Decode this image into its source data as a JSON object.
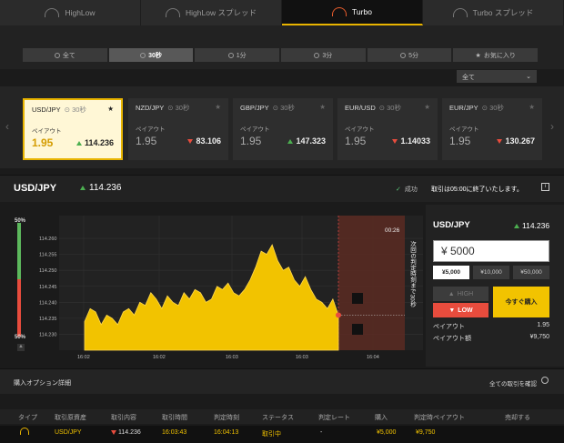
{
  "top_tabs": [
    {
      "label": "HighLow",
      "icon": "highlow-icon"
    },
    {
      "label": "HighLow スプレッド",
      "icon": "highlow-spread-icon"
    },
    {
      "label": "Turbo",
      "icon": "turbo-gauge-icon"
    },
    {
      "label": "Turbo スプレッド",
      "icon": "turbo-spread-icon"
    }
  ],
  "durations": [
    "全て",
    "30秒",
    "1分",
    "3分",
    "5分",
    "お気に入り"
  ],
  "filter": {
    "value": "全て"
  },
  "cards": [
    {
      "pair": "USD/JPY",
      "time": "30秒",
      "payout_label": "ペイアウト",
      "payout": "1.95",
      "price": "114.236",
      "dir": "up"
    },
    {
      "pair": "NZD/JPY",
      "time": "30秒",
      "payout_label": "ペイアウト",
      "payout": "1.95",
      "price": "83.106",
      "dir": "down"
    },
    {
      "pair": "GBP/JPY",
      "time": "30秒",
      "payout_label": "ペイアウト",
      "payout": "1.95",
      "price": "147.323",
      "dir": "up"
    },
    {
      "pair": "EUR/USD",
      "time": "30秒",
      "payout_label": "ペイアウト",
      "payout": "1.95",
      "price": "1.14033",
      "dir": "down"
    },
    {
      "pair": "EUR/JPY",
      "time": "30秒",
      "payout_label": "ペイアウト",
      "payout": "1.95",
      "price": "130.267",
      "dir": "down"
    }
  ],
  "instrument": {
    "name": "USD/JPY",
    "price": "114.236",
    "status": "成功",
    "close_msg": "取引は05:00に終了いたします。"
  },
  "chart": {
    "pct_top": "50%",
    "pct_bottom": "50%",
    "timer": "00:26",
    "next_text": "次回の判定時刻まで30秒",
    "y_ticks": [
      "114.260",
      "114.255",
      "114.250",
      "114.245",
      "114.240",
      "114.235",
      "114.230"
    ],
    "x_ticks": [
      "16:02",
      "16:02",
      "16:03",
      "16:03",
      "16:04"
    ]
  },
  "chart_data": {
    "type": "area",
    "ylim": [
      114.225,
      114.266
    ],
    "xlabels": [
      "16:02",
      "16:02",
      "16:03",
      "16:03",
      "16:04"
    ],
    "values": [
      114.234,
      114.238,
      114.237,
      114.233,
      114.236,
      114.235,
      114.233,
      114.237,
      114.238,
      114.236,
      114.24,
      114.239,
      114.243,
      114.241,
      114.238,
      114.242,
      114.24,
      114.239,
      114.243,
      114.241,
      114.244,
      114.243,
      114.24,
      114.241,
      114.245,
      114.244,
      114.246,
      114.243,
      114.242,
      114.244,
      114.247,
      114.251,
      114.256,
      114.255,
      114.258,
      114.253,
      114.25,
      114.251,
      114.247,
      114.245,
      114.248,
      114.244,
      114.241,
      114.24,
      114.238,
      114.241,
      114.236
    ]
  },
  "panel": {
    "title": "USD/JPY",
    "price": "114.236",
    "amount": "¥ 5000",
    "chips": [
      "¥5,000",
      "¥10,000",
      "¥50,000"
    ],
    "high": "HIGH",
    "low": "LOW",
    "buy": "今すぐ購入",
    "payout_label": "ペイアウト",
    "payout": "1.95",
    "payout_amt_label": "ペイアウト額",
    "payout_amt": "¥9,750"
  },
  "options": {
    "label": "購入オプション詳細",
    "all_confirm": "全ての取引を確認",
    "headers": [
      "タイプ",
      "取引原資産",
      "取引内容",
      "取引時間",
      "判定時刻",
      "ステータス",
      "判定レート",
      "購入",
      "判定時ペイアウト",
      "売却する"
    ],
    "row": {
      "type_icon": "turbo-gauge-icon",
      "asset": "USD/JPY",
      "content": "114.236",
      "time": "16:03:43",
      "judge": "16:04:13",
      "status": "取引中",
      "rate": "-",
      "buy": "¥5,000",
      "payout": "¥9,750"
    }
  }
}
